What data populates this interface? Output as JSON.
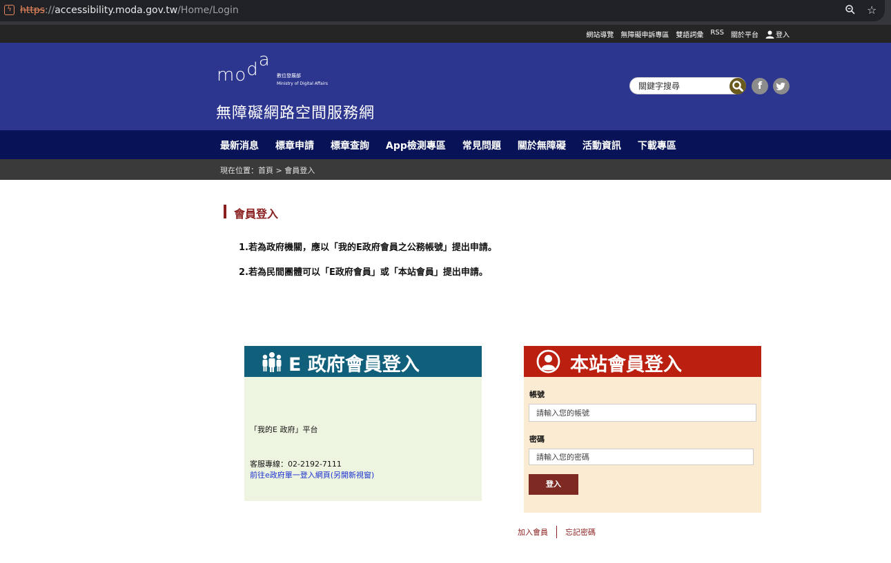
{
  "browser": {
    "url_scheme": "https",
    "url_sep": "://",
    "url_host": "accessibility.moda.gov.tw",
    "url_path": "/Home/Login"
  },
  "utility": {
    "links": [
      "網站導覽",
      "無障礙申訴專區",
      "雙語詞彙",
      "RSS",
      "關於平台"
    ],
    "login": "登入"
  },
  "header": {
    "logo_m": "mo",
    "logo_d": "d",
    "logo_a": "a",
    "logo_cn": "數位發展部",
    "logo_en": "Ministry of Digital Affairs",
    "site_title": "無障礙網路空間服務網",
    "search_placeholder": "關鍵字搜尋",
    "facebook": "f",
    "twitter": "t"
  },
  "nav": {
    "items": [
      "最新消息",
      "標章申請",
      "標章查詢",
      "App檢測專區",
      "常見問題",
      "關於無障礙",
      "活動資訊",
      "下載專區"
    ]
  },
  "breadcrumb": {
    "text": "現在位置：首頁 > 會員登入"
  },
  "content": {
    "heading": "會員登入",
    "note1": "1.若為政府機關，應以「我的E政府會員之公務帳號」提出申請。",
    "note2": "2.若為民間團體可以「E政府會員」或「本站會員」提出申請。"
  },
  "egov": {
    "title": "E 政府會員登入",
    "platform": "「我的E 政府」平台",
    "phone": "客服專線：02-2192-7111",
    "link": "前往e政府單一登入網頁(另開新視窗)"
  },
  "site_login": {
    "title": "本站會員登入",
    "account_label": "帳號",
    "account_placeholder": "請輸入您的帳號",
    "password_label": "密碼",
    "password_placeholder": "請輸入您的密碼",
    "login_button": "登入",
    "join": "加入會員",
    "forgot": "忘記密碼"
  },
  "colors": {
    "header_blue": "#2d368f",
    "nav_navy": "#071356",
    "egov_teal": "#11607b",
    "site_red": "#ba1f0f",
    "heading_maroon": "#8a1f1f"
  }
}
